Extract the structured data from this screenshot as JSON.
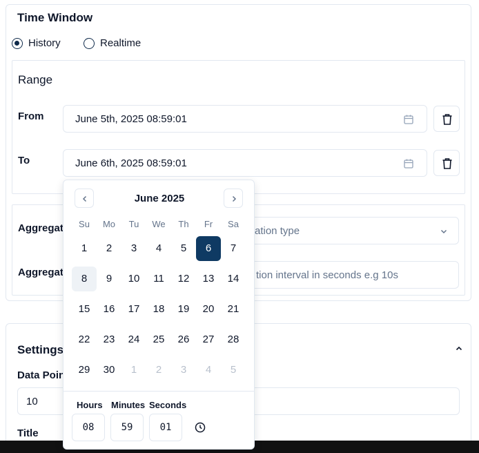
{
  "time_window": {
    "title": "Time Window",
    "modes": [
      {
        "label": "History",
        "selected": true
      },
      {
        "label": "Realtime",
        "selected": false
      }
    ],
    "range": {
      "title": "Range",
      "from_label": "From",
      "from_value": "June 5th, 2025 08:59:01",
      "to_label": "To",
      "to_value": "June 6th, 2025 08:59:01"
    },
    "aggregation": {
      "type_label": "Aggregati",
      "type_placeholder": "ation type",
      "interval_label": "Aggregati",
      "interval_placeholder": "tion interval in seconds e.g 10s"
    }
  },
  "settings": {
    "title": "Settings",
    "data_points_label": "Data Point",
    "data_points_value": "10",
    "title_label": "Title"
  },
  "calendar": {
    "month_label": "June 2025",
    "weekdays": [
      "Su",
      "Mo",
      "Tu",
      "We",
      "Th",
      "Fr",
      "Sa"
    ],
    "weeks": [
      [
        "1",
        "2",
        "3",
        "4",
        "5",
        "6",
        "7"
      ],
      [
        "8",
        "9",
        "10",
        "11",
        "12",
        "13",
        "14"
      ],
      [
        "15",
        "16",
        "17",
        "18",
        "19",
        "20",
        "21"
      ],
      [
        "22",
        "23",
        "24",
        "25",
        "26",
        "27",
        "28"
      ],
      [
        "29",
        "30",
        "1",
        "2",
        "3",
        "4",
        "5"
      ]
    ],
    "selected_day": "6",
    "today_day": "8",
    "time": {
      "hours_label": "Hours",
      "hours": "08",
      "minutes_label": "Minutes",
      "minutes": "59",
      "seconds_label": "Seconds",
      "seconds": "01"
    }
  },
  "colors": {
    "accent": "#0f3a63",
    "border": "#e2e8f0",
    "muted_text": "#64748b"
  }
}
